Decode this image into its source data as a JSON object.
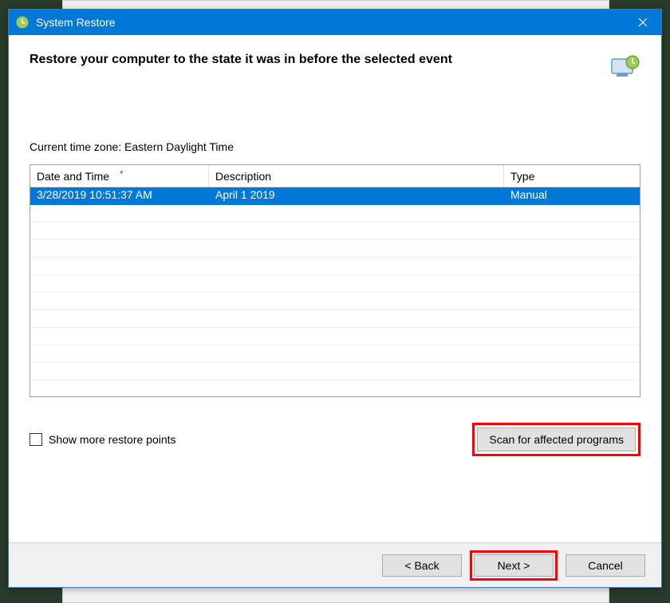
{
  "window": {
    "title": "System Restore"
  },
  "header": {
    "instruction": "Restore your computer to the state it was in before the selected event"
  },
  "timezone": {
    "label": "Current time zone: Eastern Daylight Time"
  },
  "table": {
    "columns": {
      "date": "Date and Time",
      "description": "Description",
      "type": "Type"
    },
    "rows": [
      {
        "date": "3/28/2019 10:51:37 AM",
        "description": "April 1 2019",
        "type": "Manual",
        "selected": true
      }
    ]
  },
  "showMore": {
    "label": "Show more restore points",
    "checked": false
  },
  "scan": {
    "label": "Scan for affected programs"
  },
  "buttons": {
    "back": "< Back",
    "next": "Next >",
    "cancel": "Cancel"
  }
}
